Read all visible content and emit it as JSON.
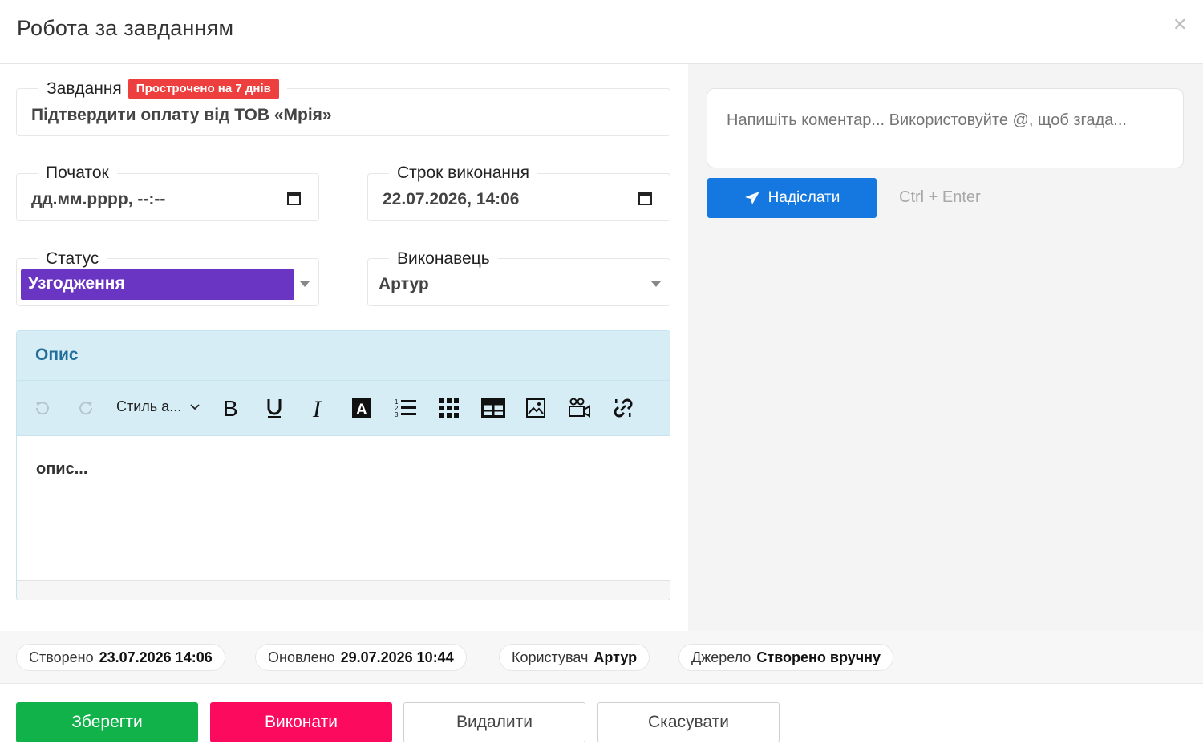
{
  "modal": {
    "title": "Робота за завданням",
    "close_icon": "close-icon"
  },
  "task": {
    "label": "Завдання",
    "overdue_badge": "Прострочено на 7 днів",
    "value": "Підтвердити оплату від ТОВ «Мрія»"
  },
  "start": {
    "label": "Початок",
    "value": "дд.мм.рррр, --:--"
  },
  "deadline": {
    "label": "Строк виконання",
    "value": "22.07.2026, 14:06"
  },
  "status": {
    "label": "Статус",
    "value": "Узгодження",
    "color": "#6b35c4"
  },
  "assignee": {
    "label": "Виконавець",
    "value": "Артур"
  },
  "description": {
    "title": "Опис",
    "style_select": "Стиль а...",
    "placeholder": "опис...",
    "toolbar_icons": [
      "undo-icon",
      "redo-icon",
      "bold-icon",
      "underline-icon",
      "italic-icon",
      "font-color-icon",
      "ordered-list-icon",
      "grid-icon",
      "table-icon",
      "image-icon",
      "video-icon",
      "link-icon"
    ]
  },
  "comment": {
    "placeholder": "Напишіть коментар... Використовуйте @, щоб згада...",
    "send_label": "Надіслати",
    "shortcut_hint": "Ctrl + Enter"
  },
  "meta": {
    "created_label": "Створено",
    "created_value": "23.07.2026 14:06",
    "updated_label": "Оновлено",
    "updated_value": "29.07.2026 10:44",
    "user_label": "Користувач",
    "user_value": "Артур",
    "source_label": "Джерело",
    "source_value": "Створено вручну"
  },
  "actions": {
    "save": "Зберегти",
    "complete": "Виконати",
    "delete": "Видалити",
    "cancel": "Скасувати"
  },
  "colors": {
    "send": "#1577e0",
    "save": "#12b24a",
    "complete": "#fb0a5d",
    "overdue": "#ee3f3f",
    "desc_header": "#d7edf6"
  }
}
